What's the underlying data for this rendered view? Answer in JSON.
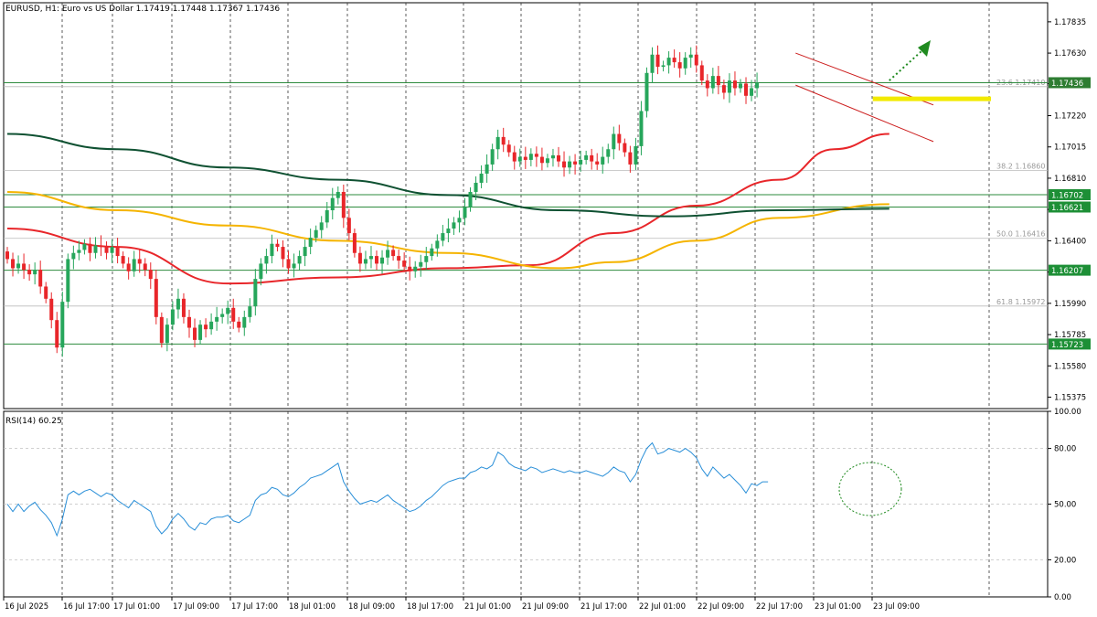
{
  "header": {
    "symbol": "EURUSD, H1:  Euro vs US Dollar  1.17419 1.17448 1.17367 1.17436"
  },
  "colors": {
    "bull": "#26a65b",
    "bear": "#e8262a",
    "ma_fast": "#e8262a",
    "ma_mid": "#f5b400",
    "ma_slow": "#0f5132",
    "level": "#2e8b3e",
    "rsi": "#2a8fd8",
    "target": "#f2ea00",
    "arrow": "#1f8a1f",
    "channel": "#cc1c1c",
    "fib": "#999999"
  },
  "chart_data": [
    {
      "type": "candlestick",
      "title": "EURUSD, H1",
      "ylim": [
        1.153,
        1.1796
      ],
      "y_ticks": [
        1.17835,
        1.1763,
        1.1743,
        1.1722,
        1.17015,
        1.1681,
        1.16605,
        1.164,
        1.16195,
        1.1599,
        1.15785,
        1.1558,
        1.15375
      ],
      "y_tick_labels": [
        "1.17835",
        "1.17630",
        "",
        "1.17220",
        "1.17015",
        "1.16810",
        "",
        "1.16400",
        "",
        "1.15990",
        "1.15785",
        "1.15580",
        "1.15375"
      ],
      "x_tick_labels": [
        "16 Jul 2025",
        "16 Jul 17:00",
        "17 Jul 01:00",
        "17 Jul 09:00",
        "17 Jul 17:00",
        "18 Jul 01:00",
        "18 Jul 09:00",
        "18 Jul 17:00",
        "21 Jul 01:00",
        "21 Jul 09:00",
        "21 Jul 17:00",
        "22 Jul 01:00",
        "22 Jul 09:00",
        "22 Jul 17:00",
        "23 Jul 01:00",
        "23 Jul 09:00"
      ],
      "closes": [
        1.1628,
        1.1622,
        1.1625,
        1.1621,
        1.1618,
        1.1621,
        1.161,
        1.1602,
        1.1588,
        1.157,
        1.16,
        1.1628,
        1.1632,
        1.1634,
        1.1638,
        1.1632,
        1.1637,
        1.1636,
        1.1632,
        1.1636,
        1.163,
        1.1625,
        1.162,
        1.1628,
        1.1625,
        1.1621,
        1.1615,
        1.159,
        1.1573,
        1.1585,
        1.1595,
        1.1602,
        1.159,
        1.1583,
        1.1575,
        1.1585,
        1.1582,
        1.1587,
        1.159,
        1.1592,
        1.1596,
        1.1587,
        1.1583,
        1.159,
        1.1597,
        1.1615,
        1.1625,
        1.163,
        1.1638,
        1.1636,
        1.1628,
        1.1622,
        1.1625,
        1.163,
        1.1636,
        1.1642,
        1.1647,
        1.1652,
        1.166,
        1.1668,
        1.1672,
        1.1655,
        1.1645,
        1.1632,
        1.1625,
        1.1628,
        1.163,
        1.1625,
        1.1629,
        1.1634,
        1.163,
        1.1627,
        1.1623,
        1.162,
        1.1623,
        1.1626,
        1.163,
        1.1635,
        1.164,
        1.1645,
        1.1648,
        1.1652,
        1.1655,
        1.1662,
        1.1672,
        1.1678,
        1.1684,
        1.169,
        1.17,
        1.1708,
        1.1703,
        1.1698,
        1.1692,
        1.1695,
        1.1693,
        1.1697,
        1.1695,
        1.1691,
        1.1694,
        1.1696,
        1.1692,
        1.1688,
        1.1692,
        1.169,
        1.1693,
        1.1696,
        1.1692,
        1.169,
        1.1695,
        1.17,
        1.171,
        1.1704,
        1.1698,
        1.169,
        1.1702,
        1.1725,
        1.175,
        1.1762,
        1.1754,
        1.1755,
        1.176,
        1.1757,
        1.1753,
        1.176,
        1.1762,
        1.1755,
        1.1745,
        1.174,
        1.1748,
        1.1742,
        1.1737,
        1.1745,
        1.174,
        1.1743,
        1.1735,
        1.174,
        1.17436
      ],
      "moving_averages": [
        {
          "label": "",
          "color_key": "ma_fast",
          "points": [
            [
              0,
              1.1648
            ],
            [
              20,
              1.1636
            ],
            [
              40,
              1.1612
            ],
            [
              60,
              1.1616
            ],
            [
              80,
              1.1622
            ],
            [
              95,
              1.1624
            ],
            [
              110,
              1.1645
            ],
            [
              125,
              1.1663
            ],
            [
              140,
              1.168
            ],
            [
              150,
              1.17
            ],
            [
              160,
              1.171
            ]
          ]
        },
        {
          "label": "",
          "color_key": "ma_mid",
          "points": [
            [
              0,
              1.1672
            ],
            [
              20,
              1.166
            ],
            [
              40,
              1.165
            ],
            [
              60,
              1.164
            ],
            [
              80,
              1.1632
            ],
            [
              100,
              1.1622
            ],
            [
              110,
              1.1626
            ],
            [
              125,
              1.164
            ],
            [
              140,
              1.1655
            ],
            [
              160,
              1.1664
            ]
          ]
        },
        {
          "label": "",
          "color_key": "ma_slow",
          "points": [
            [
              0,
              1.171
            ],
            [
              20,
              1.17
            ],
            [
              40,
              1.1688
            ],
            [
              60,
              1.168
            ],
            [
              80,
              1.167
            ],
            [
              100,
              1.166
            ],
            [
              120,
              1.1656
            ],
            [
              140,
              1.166
            ],
            [
              160,
              1.1661
            ]
          ]
        }
      ],
      "horizontal_levels": [
        {
          "value": 1.17436,
          "label": "1.17436",
          "style": "current"
        },
        {
          "value": 1.16702,
          "label": "1.16702",
          "style": "level"
        },
        {
          "value": 1.16621,
          "label": "1.16621",
          "style": "level"
        },
        {
          "value": 1.16207,
          "label": "1.16207",
          "style": "level"
        },
        {
          "value": 1.15723,
          "label": "1.15723",
          "style": "level"
        }
      ],
      "fib_levels": [
        {
          "value": 1.1741,
          "label": "23.6  1.17410"
        },
        {
          "value": 1.1686,
          "label": "38.2  1.16860"
        },
        {
          "value": 1.16416,
          "label": "50.0  1.16416"
        },
        {
          "value": 1.15972,
          "label": "61.8  1.15972"
        }
      ],
      "target_zone": {
        "value": 1.1733
      }
    },
    {
      "type": "line",
      "title": "RSI(14) 60.25",
      "ylim": [
        0,
        100
      ],
      "y_ticks": [
        100,
        80,
        50,
        20,
        0
      ],
      "y_tick_labels": [
        "100.00",
        "80.00",
        "50.00",
        "20.00",
        "0.00"
      ],
      "values": [
        50,
        46,
        50,
        46,
        49,
        51,
        47,
        44,
        40,
        33,
        42,
        55,
        57,
        55,
        57,
        58,
        56,
        54,
        56,
        55,
        52,
        50,
        48,
        52,
        50,
        48,
        46,
        38,
        34,
        37,
        42,
        45,
        42,
        38,
        36,
        40,
        39,
        42,
        43,
        43,
        44,
        41,
        40,
        42,
        44,
        52,
        55,
        56,
        59,
        58,
        55,
        54,
        56,
        59,
        61,
        64,
        65,
        66,
        68,
        70,
        72,
        62,
        57,
        53,
        50,
        51,
        52,
        51,
        53,
        55,
        52,
        50,
        48,
        46,
        47,
        49,
        52,
        54,
        57,
        60,
        62,
        63,
        64,
        64,
        67,
        68,
        70,
        69,
        71,
        78,
        76,
        72,
        70,
        69,
        68,
        70,
        69,
        67,
        68,
        69,
        68,
        67,
        68,
        67,
        67,
        68,
        67,
        66,
        65,
        67,
        70,
        68,
        67,
        62,
        66,
        74,
        80,
        83,
        77,
        78,
        80,
        79,
        78,
        80,
        78,
        75,
        69,
        65,
        70,
        67,
        64,
        66,
        63,
        60,
        56,
        61,
        60,
        62,
        62
      ],
      "levels": [
        80,
        50,
        20
      ]
    }
  ]
}
